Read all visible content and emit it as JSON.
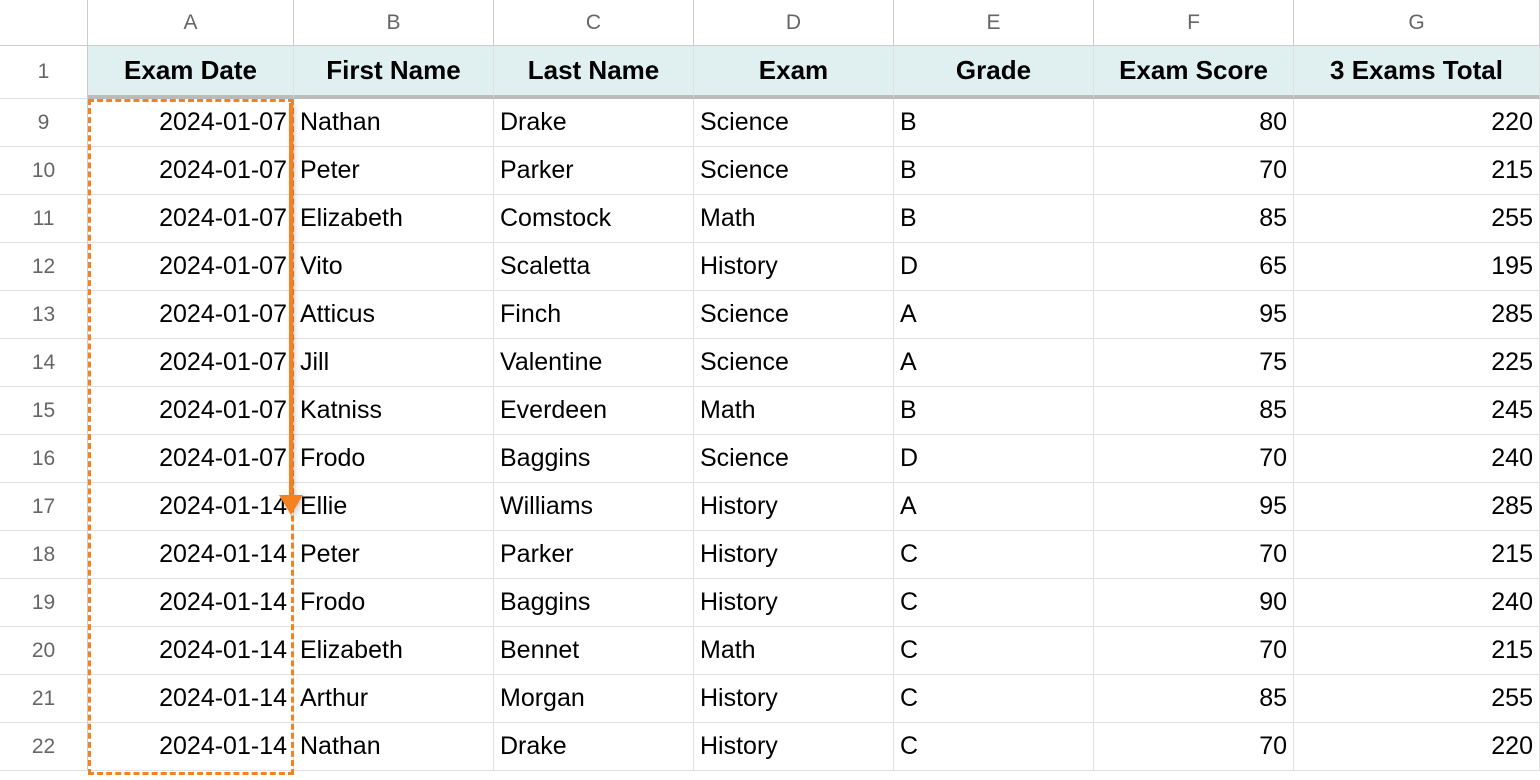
{
  "colLetters": [
    "A",
    "B",
    "C",
    "D",
    "E",
    "F",
    "G"
  ],
  "headers": [
    "Exam Date",
    "First Name",
    "Last Name",
    "Exam",
    "Grade",
    "Exam Score",
    "3 Exams Total"
  ],
  "headerRowNum": "1",
  "rows": [
    {
      "num": "9",
      "date": "2024-01-07",
      "first": "Nathan",
      "last": "Drake",
      "exam": "Science",
      "grade": "B",
      "score": "80",
      "total": "220"
    },
    {
      "num": "10",
      "date": "2024-01-07",
      "first": "Peter",
      "last": "Parker",
      "exam": "Science",
      "grade": "B",
      "score": "70",
      "total": "215"
    },
    {
      "num": "11",
      "date": "2024-01-07",
      "first": "Elizabeth",
      "last": "Comstock",
      "exam": "Math",
      "grade": "B",
      "score": "85",
      "total": "255"
    },
    {
      "num": "12",
      "date": "2024-01-07",
      "first": "Vito",
      "last": "Scaletta",
      "exam": "History",
      "grade": "D",
      "score": "65",
      "total": "195"
    },
    {
      "num": "13",
      "date": "2024-01-07",
      "first": "Atticus",
      "last": "Finch",
      "exam": "Science",
      "grade": "A",
      "score": "95",
      "total": "285"
    },
    {
      "num": "14",
      "date": "2024-01-07",
      "first": "Jill",
      "last": "Valentine",
      "exam": "Science",
      "grade": "A",
      "score": "75",
      "total": "225"
    },
    {
      "num": "15",
      "date": "2024-01-07",
      "first": "Katniss",
      "last": "Everdeen",
      "exam": "Math",
      "grade": "B",
      "score": "85",
      "total": "245"
    },
    {
      "num": "16",
      "date": "2024-01-07",
      "first": "Frodo",
      "last": "Baggins",
      "exam": "Science",
      "grade": "D",
      "score": "70",
      "total": "240"
    },
    {
      "num": "17",
      "date": "2024-01-14",
      "first": "Ellie",
      "last": "Williams",
      "exam": "History",
      "grade": "A",
      "score": "95",
      "total": "285"
    },
    {
      "num": "18",
      "date": "2024-01-14",
      "first": "Peter",
      "last": "Parker",
      "exam": "History",
      "grade": "C",
      "score": "70",
      "total": "215"
    },
    {
      "num": "19",
      "date": "2024-01-14",
      "first": "Frodo",
      "last": "Baggins",
      "exam": "History",
      "grade": "C",
      "score": "90",
      "total": "240"
    },
    {
      "num": "20",
      "date": "2024-01-14",
      "first": "Elizabeth",
      "last": "Bennet",
      "exam": "Math",
      "grade": "C",
      "score": "70",
      "total": "215"
    },
    {
      "num": "21",
      "date": "2024-01-14",
      "first": "Arthur",
      "last": "Morgan",
      "exam": "History",
      "grade": "C",
      "score": "85",
      "total": "255"
    },
    {
      "num": "22",
      "date": "2024-01-14",
      "first": "Nathan",
      "last": "Drake",
      "exam": "History",
      "grade": "C",
      "score": "70",
      "total": "220"
    }
  ]
}
